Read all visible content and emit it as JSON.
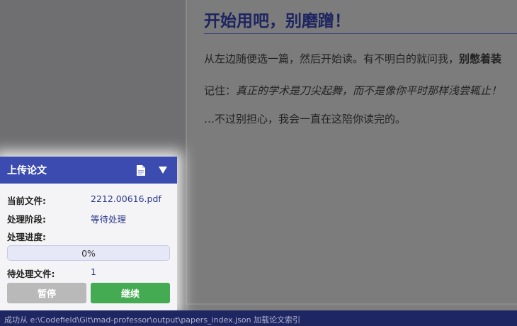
{
  "main": {
    "title": "开始用吧，别磨蹭！",
    "para1_prefix": "从左边随便选一篇，然后开始读。有不明白的就问我，",
    "para1_bold": "别憋着装",
    "para2_prefix": "记住：",
    "para2_italic": "真正的学术是刀尖起舞，而不是像你平时那样浅尝辄止！",
    "para3": "…不过别担心，我会一直在这陪你读完的。"
  },
  "upload": {
    "title": "上传论文",
    "current_file_label": "当前文件:",
    "current_file_value": "2212.00616.pdf",
    "stage_label": "处理阶段:",
    "stage_value": "等待处理",
    "progress_label": "处理进度:",
    "progress_text": "0%",
    "progress_fraction": 0,
    "pending_label": "待处理文件:",
    "pending_value": "1",
    "pause_label": "暂停",
    "continue_label": "继续",
    "icons": [
      "file-icon",
      "collapse-triangle-icon"
    ]
  },
  "status_bar": {
    "text": "成功从 e:\\Codefield\\Git\\mad-professor\\output\\papers_index.json 加载论文索引"
  },
  "colors": {
    "accent": "#3b4bb0",
    "continue_green": "#45ab52",
    "pause_gray": "#b9b9b9",
    "status_bar_bg": "#1f2763",
    "title_navy": "#1e2460"
  }
}
